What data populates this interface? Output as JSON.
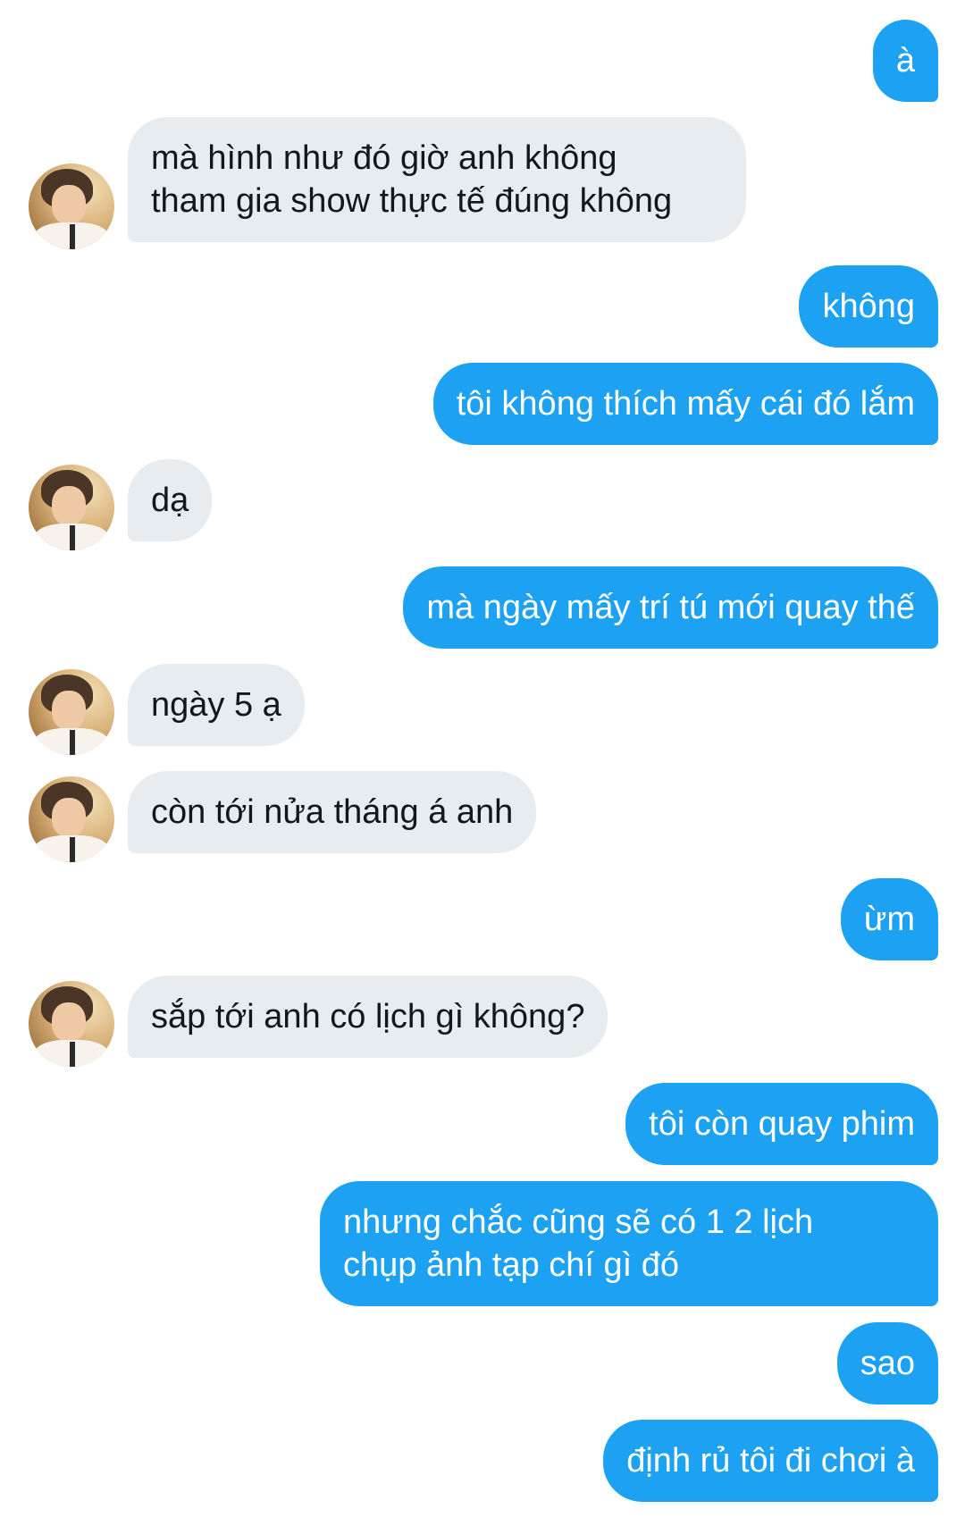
{
  "conversation": {
    "messages": [
      {
        "from": "me",
        "text": "à"
      },
      {
        "from": "them",
        "text": "mà hình như đó giờ anh không\ntham gia show thực tế đúng không"
      },
      {
        "from": "me",
        "text": "không"
      },
      {
        "from": "me",
        "text": "tôi không thích mấy cái đó lắm"
      },
      {
        "from": "them",
        "text": "dạ"
      },
      {
        "from": "me",
        "text": "mà ngày mấy trí tú mới quay thế"
      },
      {
        "from": "them",
        "text": "ngày 5 ạ"
      },
      {
        "from": "them",
        "text": "còn tới nửa tháng á anh"
      },
      {
        "from": "me",
        "text": "ừm"
      },
      {
        "from": "them",
        "text": "sắp tới anh có lịch gì không?"
      },
      {
        "from": "me",
        "text": "tôi còn quay phim"
      },
      {
        "from": "me",
        "text": "nhưng chắc cũng sẽ có 1 2 lịch\nchụp ảnh tạp chí gì đó"
      },
      {
        "from": "me",
        "text": "sao"
      },
      {
        "from": "me",
        "text": "định rủ tôi đi chơi à"
      }
    ]
  },
  "colors": {
    "outgoing_bubble": "#1da1f2",
    "incoming_bubble": "#e6ecf0",
    "outgoing_text": "#ffffff",
    "incoming_text": "#14171a"
  },
  "icons": {
    "avatar": "contact-avatar-photo"
  }
}
